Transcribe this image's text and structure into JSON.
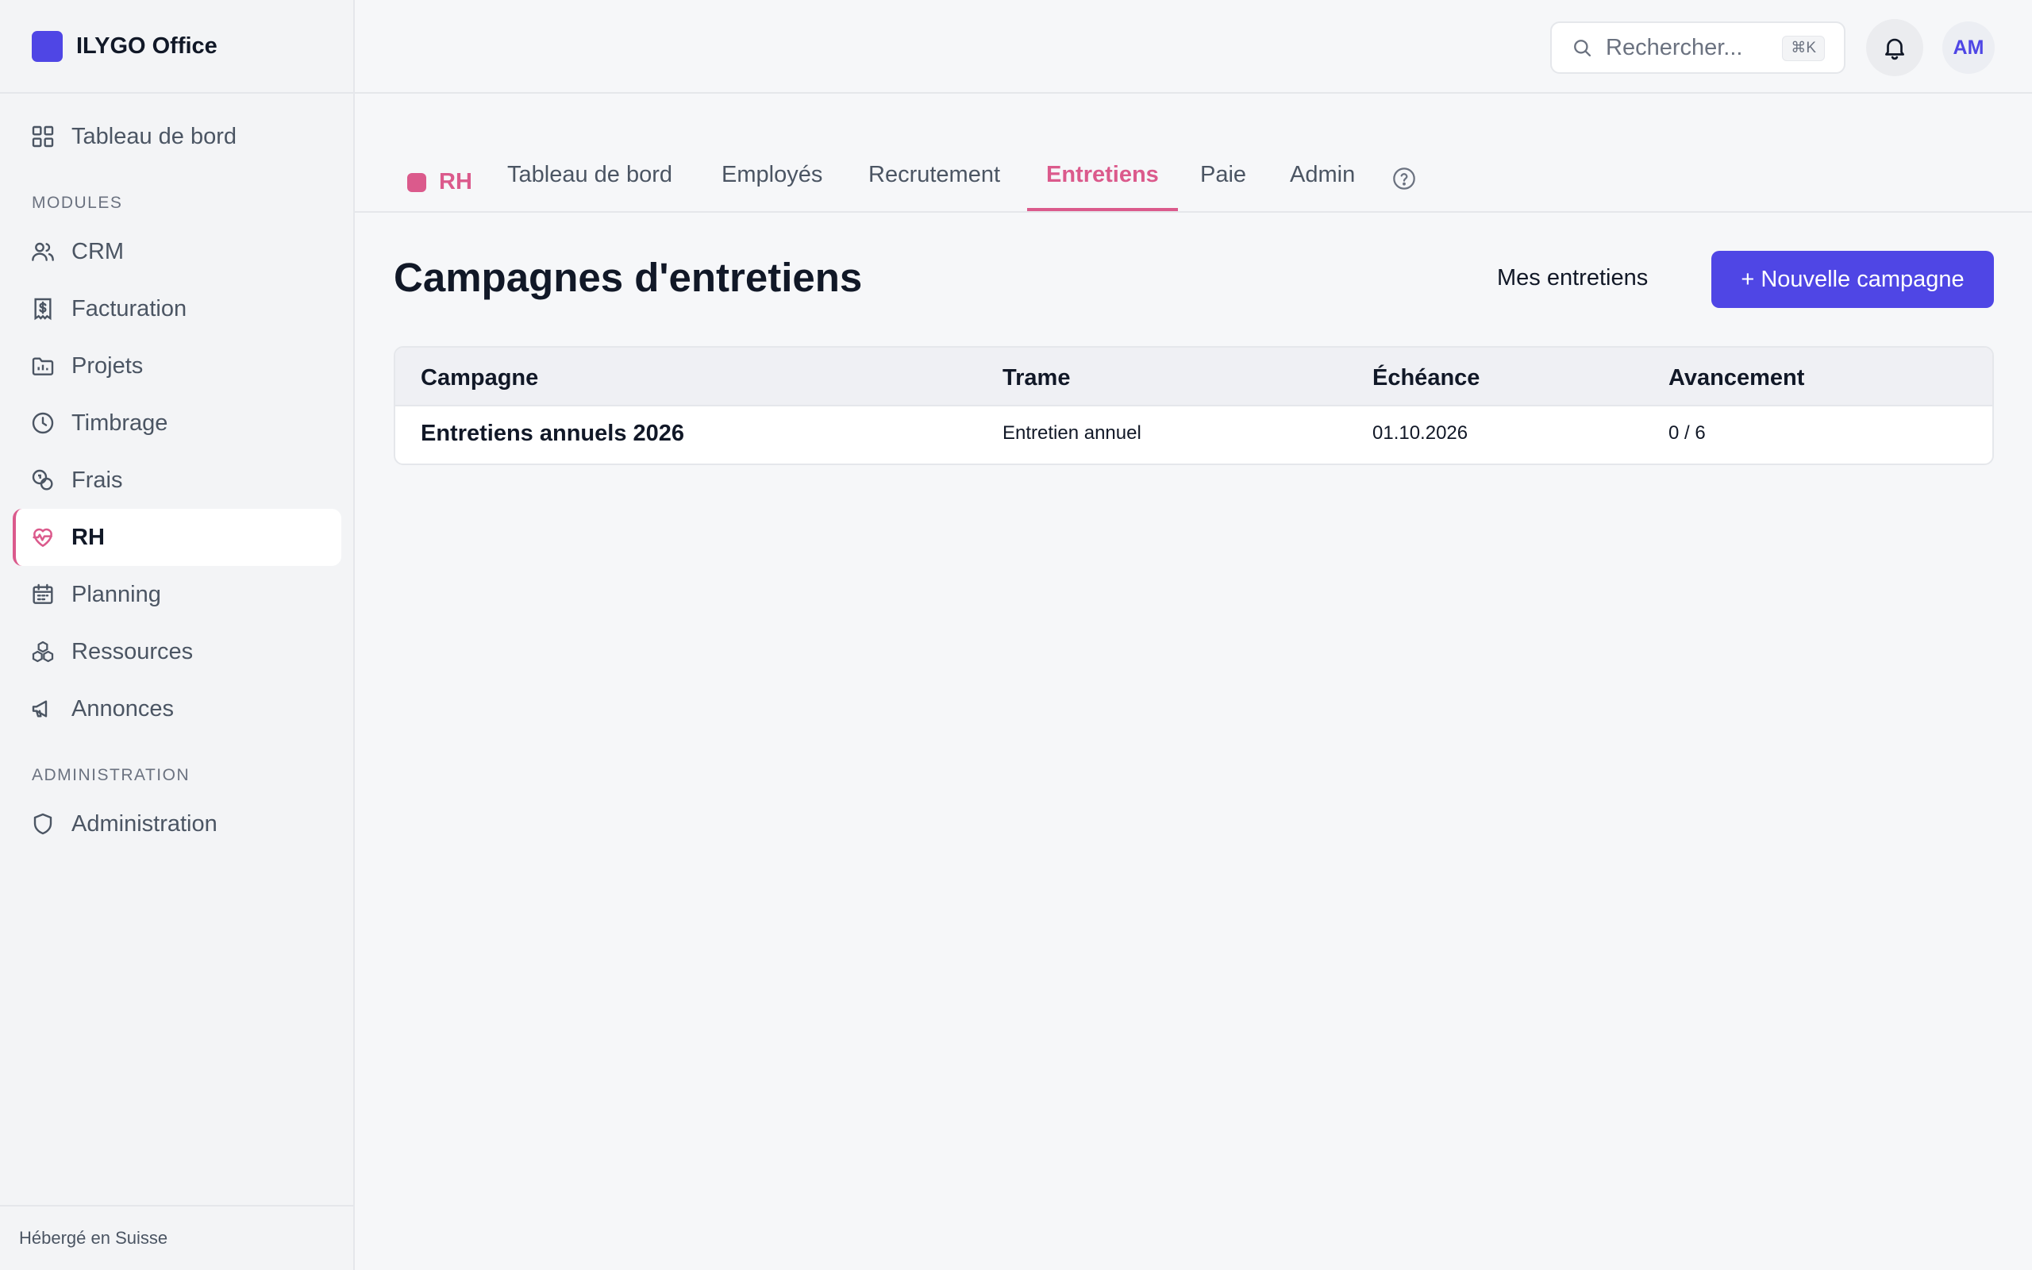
{
  "app": {
    "name": "ILYGO Office"
  },
  "sidebar": {
    "dashboard": "Tableau de bord",
    "modules_label": "MODULES",
    "items": [
      {
        "label": "CRM",
        "icon": "users-icon"
      },
      {
        "label": "Facturation",
        "icon": "invoice-icon"
      },
      {
        "label": "Projets",
        "icon": "folder-icon"
      },
      {
        "label": "Timbrage",
        "icon": "clock-icon"
      },
      {
        "label": "Frais",
        "icon": "coins-icon"
      },
      {
        "label": "RH",
        "icon": "heart-pulse-icon",
        "active": true
      },
      {
        "label": "Planning",
        "icon": "calendar-icon"
      },
      {
        "label": "Ressources",
        "icon": "boxes-icon"
      },
      {
        "label": "Annonces",
        "icon": "megaphone-icon"
      }
    ],
    "admin_label": "ADMINISTRATION",
    "admin_item": "Administration",
    "footer": "Hébergé en Suisse"
  },
  "topbar": {
    "search_placeholder": "Rechercher...",
    "search_shortcut": "⌘K",
    "avatar_initials": "AM"
  },
  "module": {
    "name": "RH",
    "color": "#db5a8c",
    "tabs": [
      "Tableau de bord",
      "Employés",
      "Recrutement",
      "Entretiens",
      "Paie",
      "Admin"
    ],
    "active_tab": "Entretiens"
  },
  "page": {
    "title": "Campagnes d'entretiens",
    "secondary_action": "Mes entretiens",
    "primary_action": "+ Nouvelle campagne"
  },
  "table": {
    "columns": [
      "Campagne",
      "Trame",
      "Échéance",
      "Avancement"
    ],
    "rows": [
      [
        "Entretiens annuels 2026",
        "Entretien annuel",
        "01.10.2026",
        "0 / 6"
      ]
    ]
  },
  "colors": {
    "accent": "#4f46e5",
    "module": "#db5a8c"
  }
}
